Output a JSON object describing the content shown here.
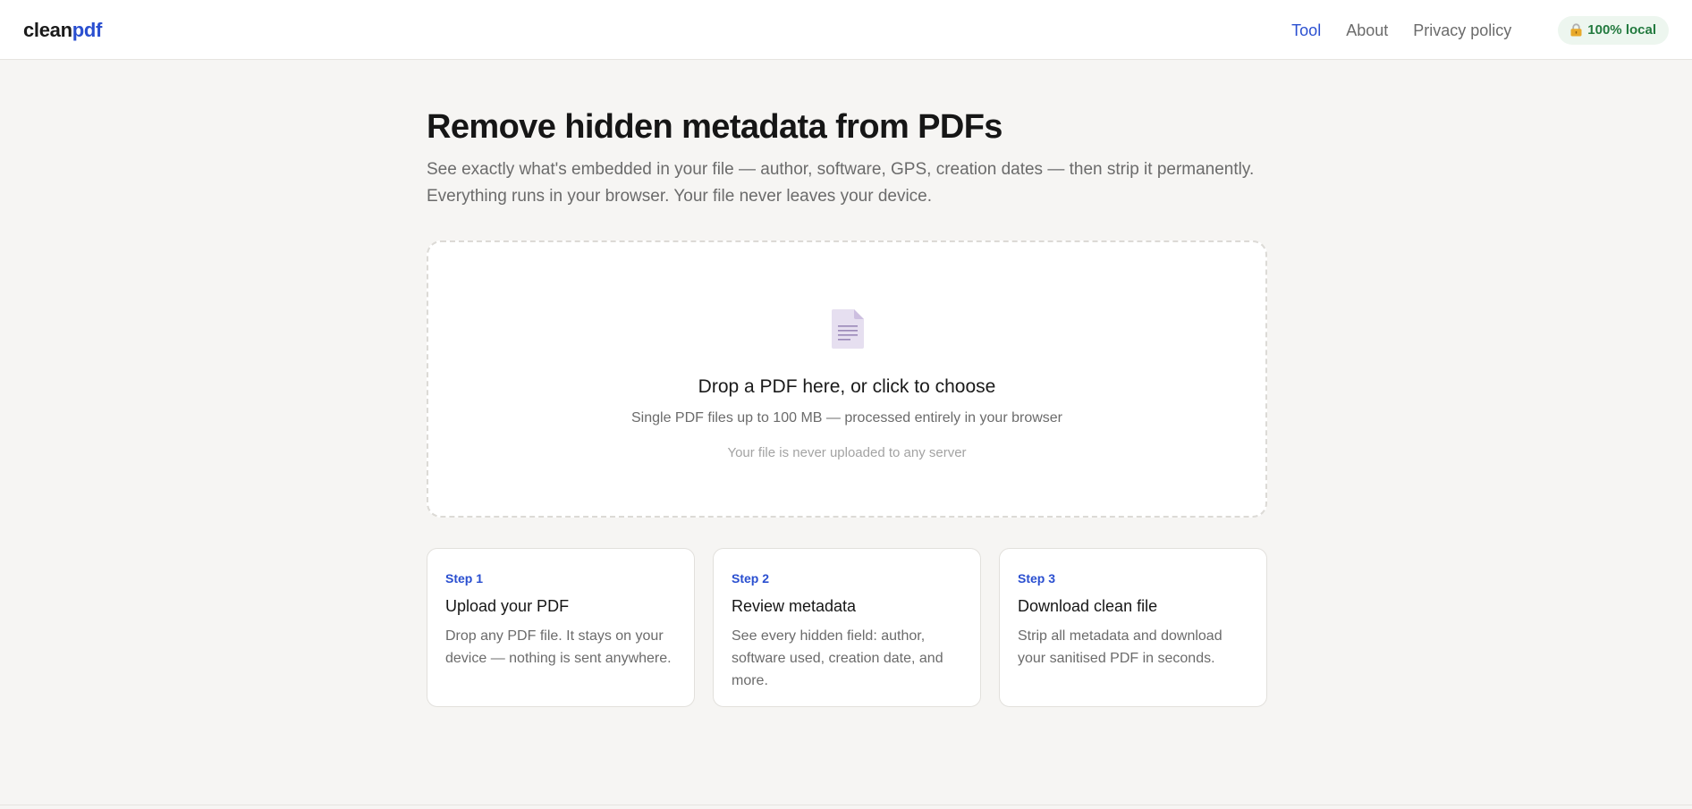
{
  "header": {
    "logo_main": "clean",
    "logo_accent": "pdf",
    "nav": [
      {
        "label": "Tool",
        "active": true
      },
      {
        "label": "About",
        "active": false
      },
      {
        "label": "Privacy policy",
        "active": false
      }
    ],
    "badge": {
      "icon": "lock-icon",
      "label": "100% local"
    }
  },
  "hero": {
    "title": "Remove hidden metadata from PDFs",
    "subtitle": "See exactly what's embedded in your file — author, software, GPS, creation dates — then strip it permanently. Everything runs in your browser. Your file never leaves your device."
  },
  "dropzone": {
    "icon": "document-icon",
    "title": "Drop a PDF here, or click to choose",
    "subtitle": "Single PDF files up to 100 MB — processed entirely in your browser",
    "note": "Your file is never uploaded to any server"
  },
  "steps": [
    {
      "label": "Step 1",
      "title": "Upload your PDF",
      "description": "Drop any PDF file. It stays on your device — nothing is sent anywhere."
    },
    {
      "label": "Step 2",
      "title": "Review metadata",
      "description": "See every hidden field: author, software used, creation date, and more."
    },
    {
      "label": "Step 3",
      "title": "Download clean file",
      "description": "Strip all metadata and download your sanitised PDF in seconds."
    }
  ],
  "colors": {
    "accent": "#2a4fd0",
    "background": "#f6f5f3",
    "badge_bg": "#edf6ef",
    "badge_text": "#237a3f"
  }
}
